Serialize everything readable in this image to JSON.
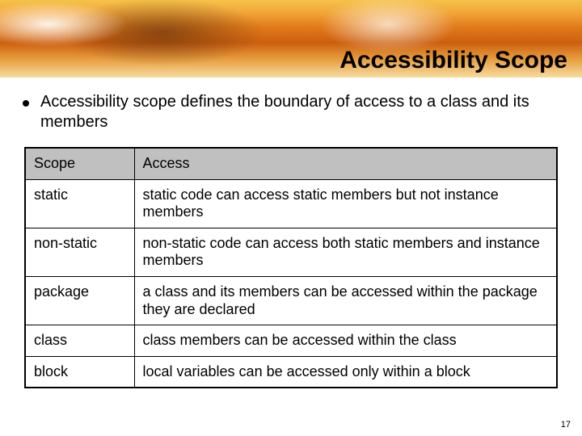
{
  "slide": {
    "title": "Accessibility Scope",
    "bullet": "Accessibility scope defines the boundary of access to a class and its members",
    "page_number": "17"
  },
  "table": {
    "headers": {
      "col1": "Scope",
      "col2": "Access"
    },
    "rows": [
      {
        "scope": "static",
        "access": "static code can access static members but not instance members"
      },
      {
        "scope": "non-static",
        "access": "non-static code can access both static members and instance members"
      },
      {
        "scope": "package",
        "access": "a class and its members can be accessed within the package they are declared"
      },
      {
        "scope": "class",
        "access": "class members can be accessed within the class"
      },
      {
        "scope": "block",
        "access": "local variables can be accessed only within a block"
      }
    ]
  }
}
